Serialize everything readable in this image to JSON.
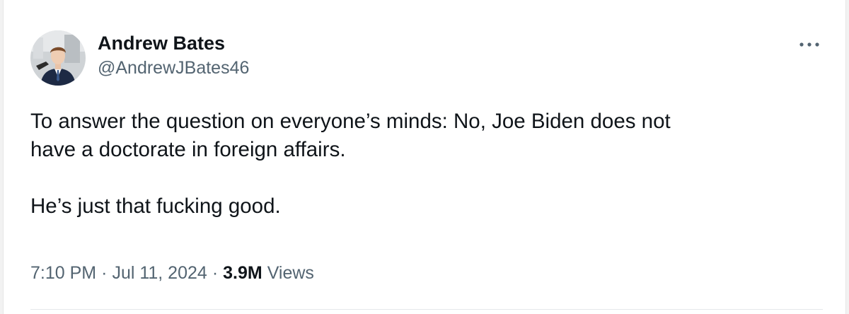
{
  "tweet": {
    "author": {
      "display_name": "Andrew Bates",
      "handle": "@AndrewJBates46",
      "avatar_icon": "profile-photo"
    },
    "more_icon": "more-horizontal-icon",
    "text_lines": [
      "To answer the question on everyone’s minds: No, Joe Biden does not",
      "have a doctorate in foreign affairs.",
      "He’s just that fucking good."
    ],
    "meta": {
      "time": "7:10 PM",
      "date": "Jul 11, 2024",
      "separator": "·",
      "views_count": "3.9M",
      "views_label": "Views"
    }
  },
  "colors": {
    "text_primary": "#0f1419",
    "text_secondary": "#536471",
    "divider": "#e5e8eb"
  }
}
